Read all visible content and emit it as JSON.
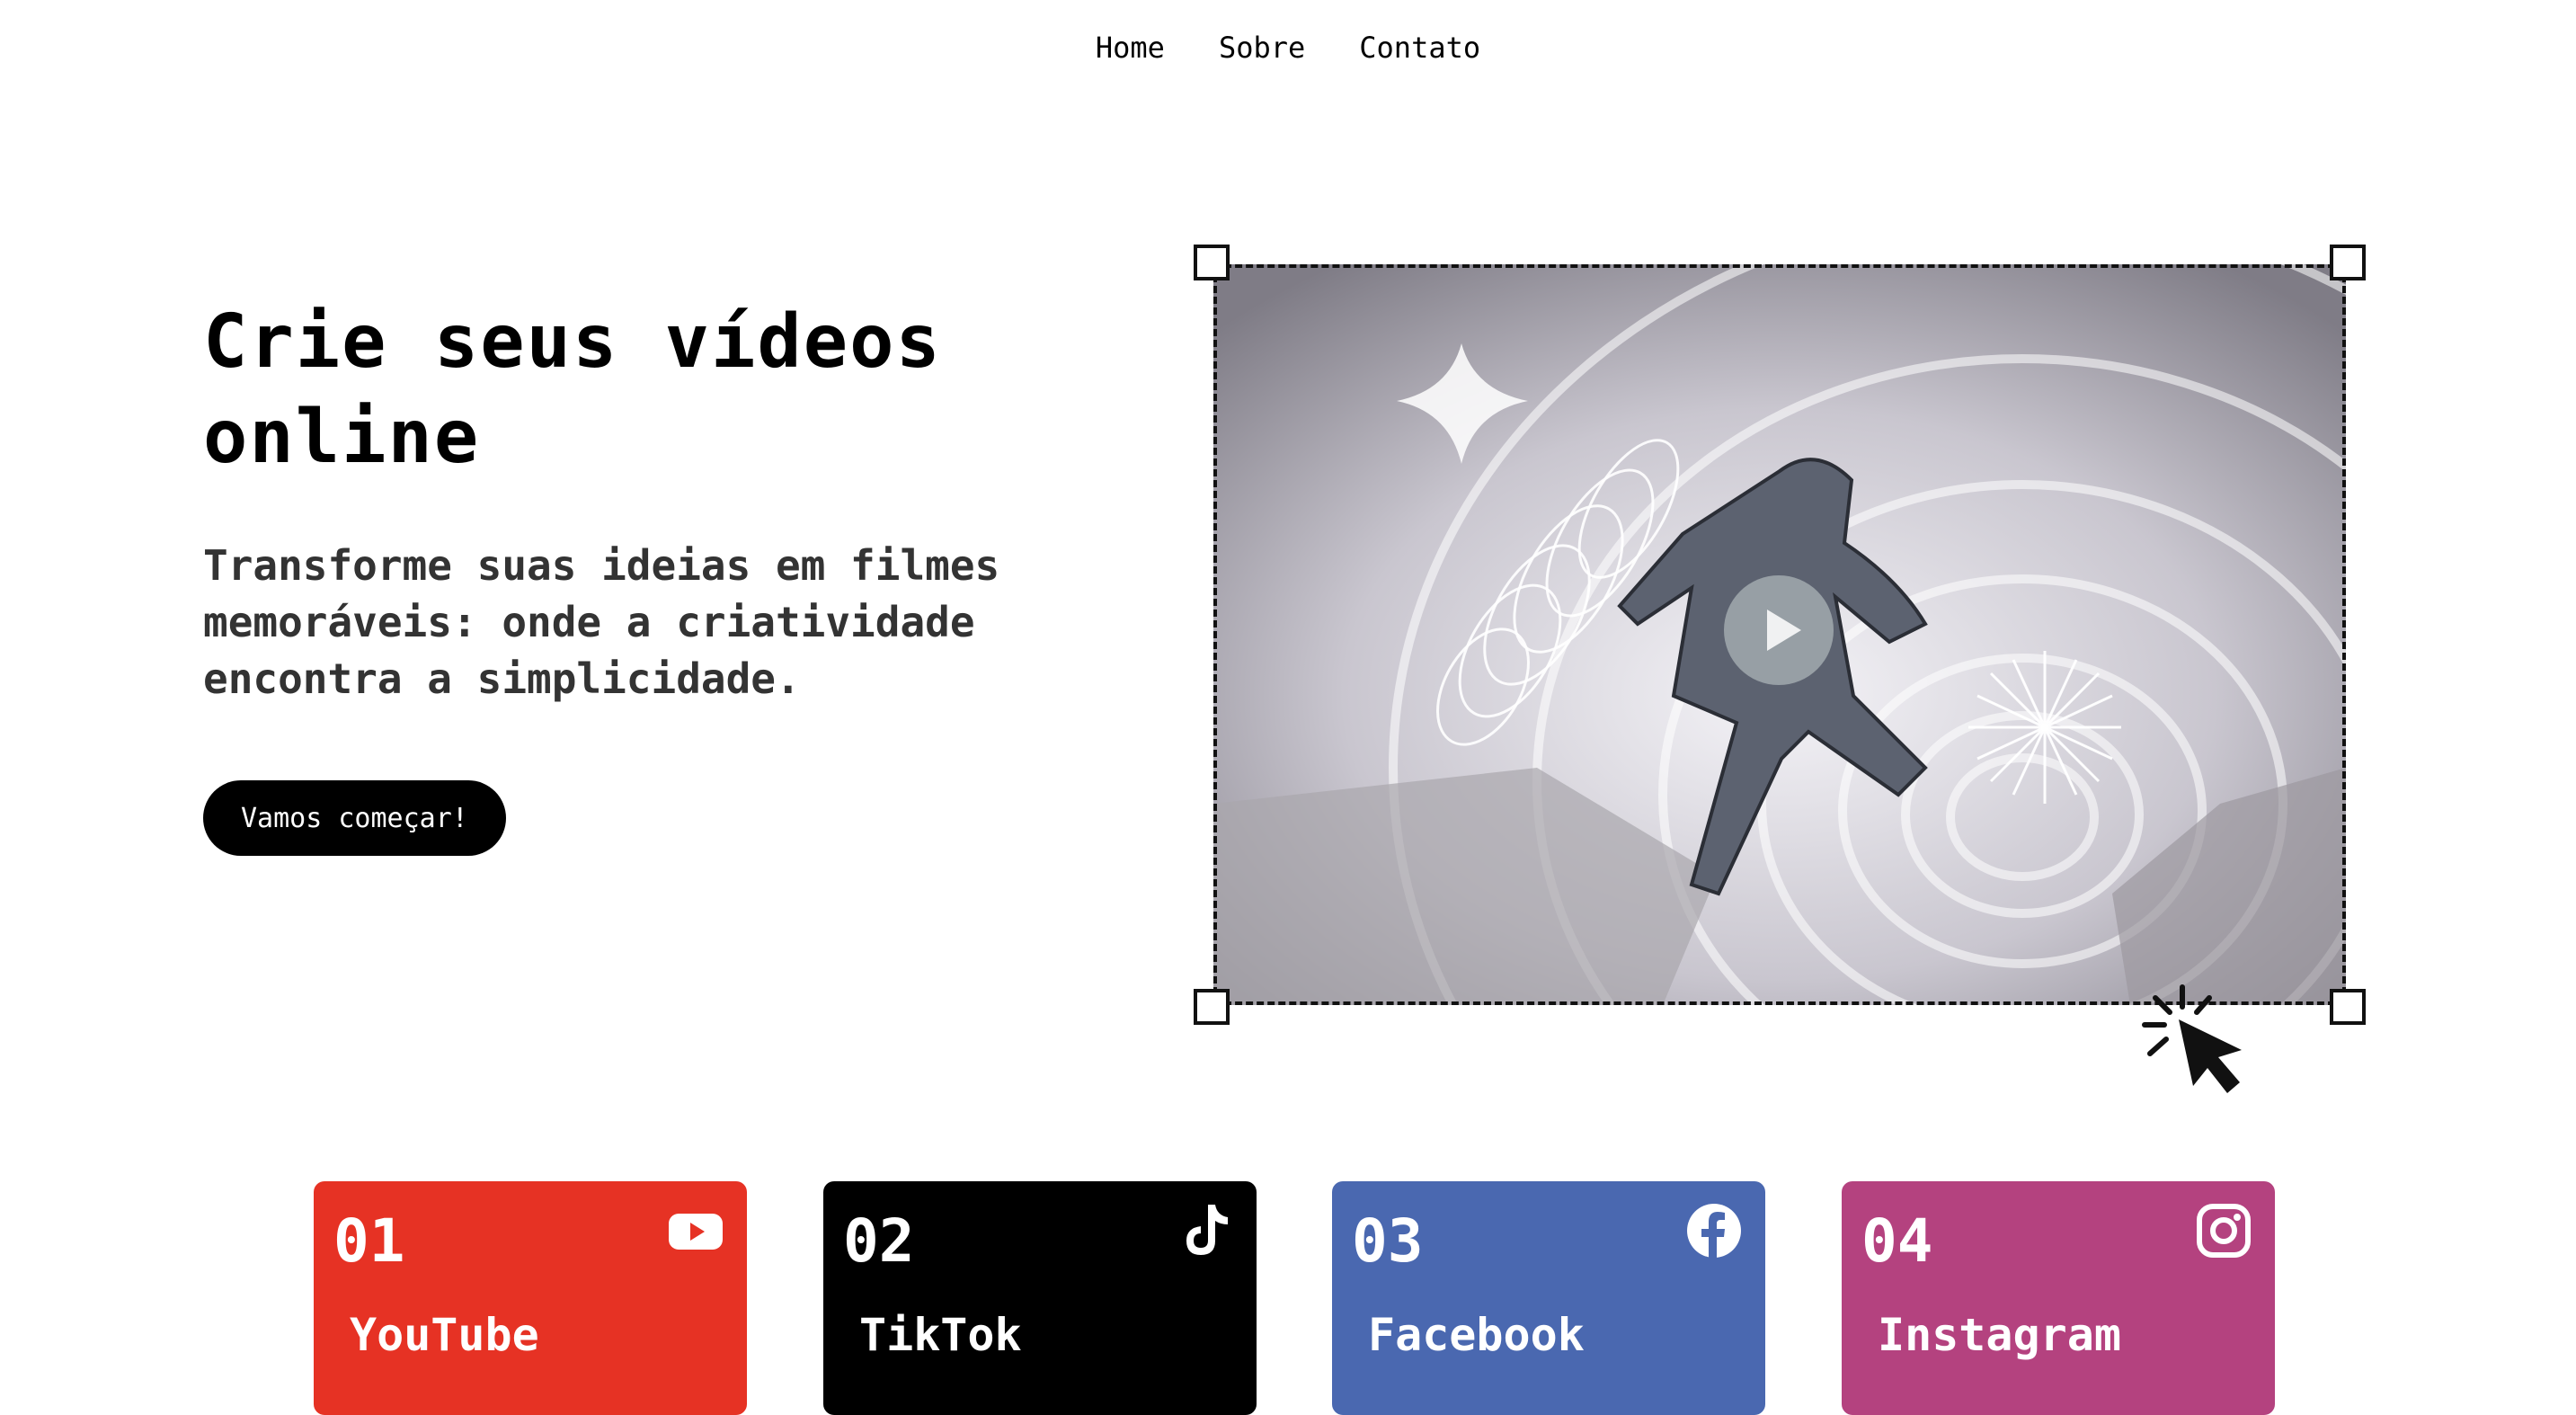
{
  "nav": {
    "items": [
      {
        "label": "Home"
      },
      {
        "label": "Sobre"
      },
      {
        "label": "Contato"
      }
    ]
  },
  "hero": {
    "title": "Crie seus vídeos online",
    "subtitle": "Transforme suas ideias em filmes memoráveis: onde a criatividade encontra a simplicidade.",
    "cta_label": "Vamos começar!"
  },
  "platforms": [
    {
      "number": "01",
      "name": "YouTube",
      "icon": "youtube-icon",
      "color": "#E63224"
    },
    {
      "number": "02",
      "name": "TikTok",
      "icon": "tiktok-icon",
      "color": "#000000"
    },
    {
      "number": "03",
      "name": "Facebook",
      "icon": "facebook-icon",
      "color": "#4A68B0"
    },
    {
      "number": "04",
      "name": "Instagram",
      "icon": "instagram-icon",
      "color": "#B4427F"
    }
  ]
}
